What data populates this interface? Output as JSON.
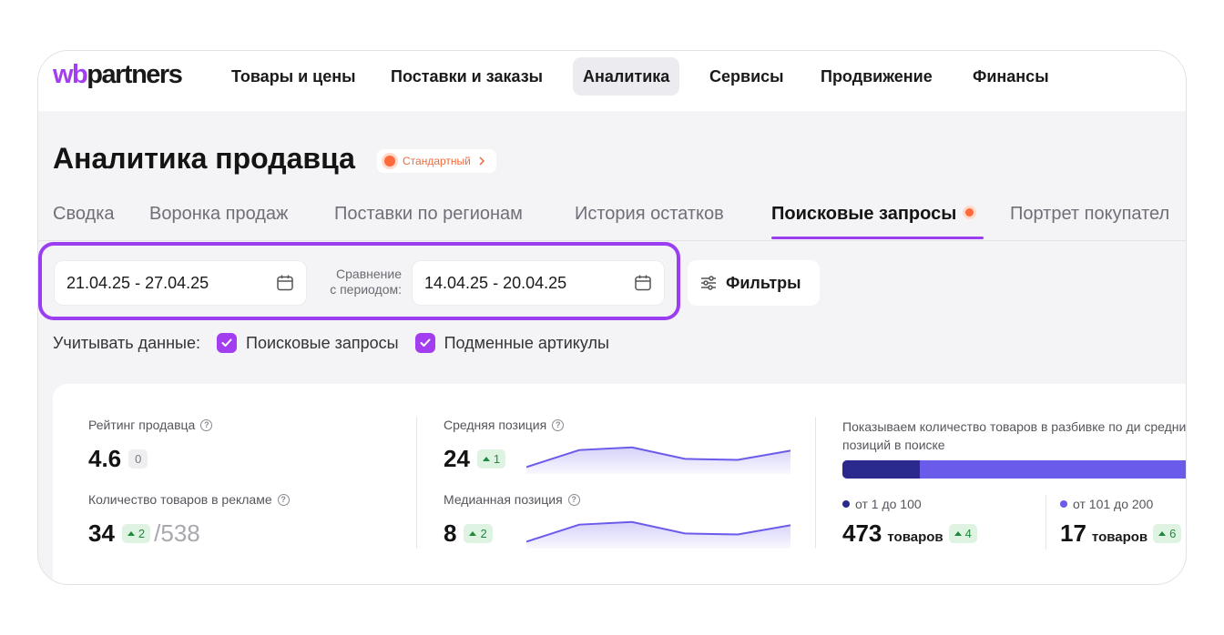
{
  "logo": {
    "part1": "wb",
    "part2": "partners"
  },
  "nav": [
    {
      "label": "Товары и цены"
    },
    {
      "label": "Поставки и заказы"
    },
    {
      "label": "Аналитика",
      "active": true
    },
    {
      "label": "Сервисы"
    },
    {
      "label": "Продвижение"
    },
    {
      "label": "Финансы"
    }
  ],
  "page": {
    "title": "Аналитика продавца",
    "tier_badge": "Стандартный"
  },
  "tabs": [
    {
      "label": "Сводка"
    },
    {
      "label": "Воронка продаж"
    },
    {
      "label": "Поставки по регионам"
    },
    {
      "label": "История остатков"
    },
    {
      "label": "Поисковые запросы",
      "active": true
    },
    {
      "label": "Портрет покупател"
    }
  ],
  "filters": {
    "period": "21.04.25 - 27.04.25",
    "compare_label_line1": "Сравнение",
    "compare_label_line2": "с периодом:",
    "compare_period": "14.04.25 - 20.04.25",
    "filters_button": "Фильтры",
    "consider_label": "Учитывать данные:",
    "checkbox1": "Поисковые запросы",
    "checkbox2": "Подменные артикулы"
  },
  "metrics": {
    "seller_rating": {
      "label": "Рейтинг продавца",
      "value": "4.6",
      "delta": "0"
    },
    "ad_products": {
      "label": "Количество товаров в рекламе",
      "value": "34",
      "delta": "2",
      "total": "/538"
    },
    "avg_position": {
      "label": "Средняя позиция",
      "value": "24",
      "delta": "1"
    },
    "median_position": {
      "label": "Медианная позиция",
      "value": "8",
      "delta": "2"
    }
  },
  "sparkline_avg": [
    0.1,
    0.62,
    0.7,
    0.35,
    0.32,
    0.6
  ],
  "sparkline_median": [
    0.1,
    0.62,
    0.7,
    0.35,
    0.32,
    0.6
  ],
  "distribution": {
    "description": "Показываем количество товаров в разбивке по ди средних позиций в поиске",
    "bar_first_share": 0.21,
    "ranges": [
      {
        "label": "от 1 до 100",
        "count": "473",
        "unit": "товаров",
        "delta": "4",
        "color": "#2a2a8c"
      },
      {
        "label": "от 101 до 200",
        "count": "17",
        "unit": "товаров",
        "delta": "6",
        "color": "#6a5bea"
      }
    ]
  },
  "colors": {
    "accent": "#9b3df0",
    "badge": "#ff6a3d",
    "positive": "#1f8a3c"
  }
}
